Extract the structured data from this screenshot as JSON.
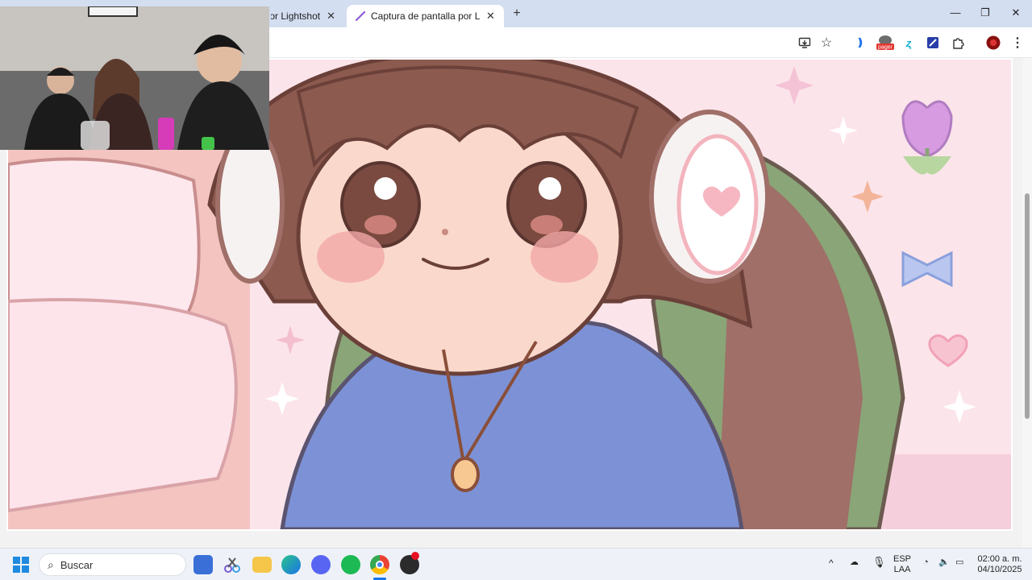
{
  "browser": {
    "tabs": [
      {
        "label": "Captura de pantalla por Lightshot",
        "active": false
      },
      {
        "label": "Captura de pantalla por Lightshot",
        "active": true
      }
    ],
    "new_tab_icon": "plus-icon",
    "window_controls": [
      "minimize-icon",
      "restore-icon",
      "close-icon"
    ],
    "toolbar_icons": [
      "install-app-icon",
      "bookmark-star-icon",
      "read-aloud-icon",
      "pager-extension-icon",
      "translate-extension-icon",
      "screenshot-extension-icon",
      "extensions-puzzle-icon",
      "profile-avatar",
      "menu-kebab-icon"
    ],
    "pager_label": "pager"
  },
  "content": {
    "image_description_icon": "illustration"
  },
  "taskbar": {
    "search_placeholder": "Buscar",
    "apps": [
      "windows-start-icon",
      "store-icon",
      "snipping-tool-icon",
      "file-explorer-icon",
      "edge-icon",
      "discord-icon",
      "spotify-icon",
      "chrome-icon",
      "obs-icon"
    ],
    "language": "ESP",
    "layout": "LAA",
    "time": "02:00 a. m.",
    "date": "04/10/2025"
  },
  "colors": {
    "tabstrip": "#d3def0",
    "accent": "#1a73e8",
    "hoodie": "#7a8fd4",
    "skin": "#f9d9cc",
    "hair": "#8c5a4f",
    "chair": "#8aa577",
    "bg_pink": "#fbe4ea"
  }
}
